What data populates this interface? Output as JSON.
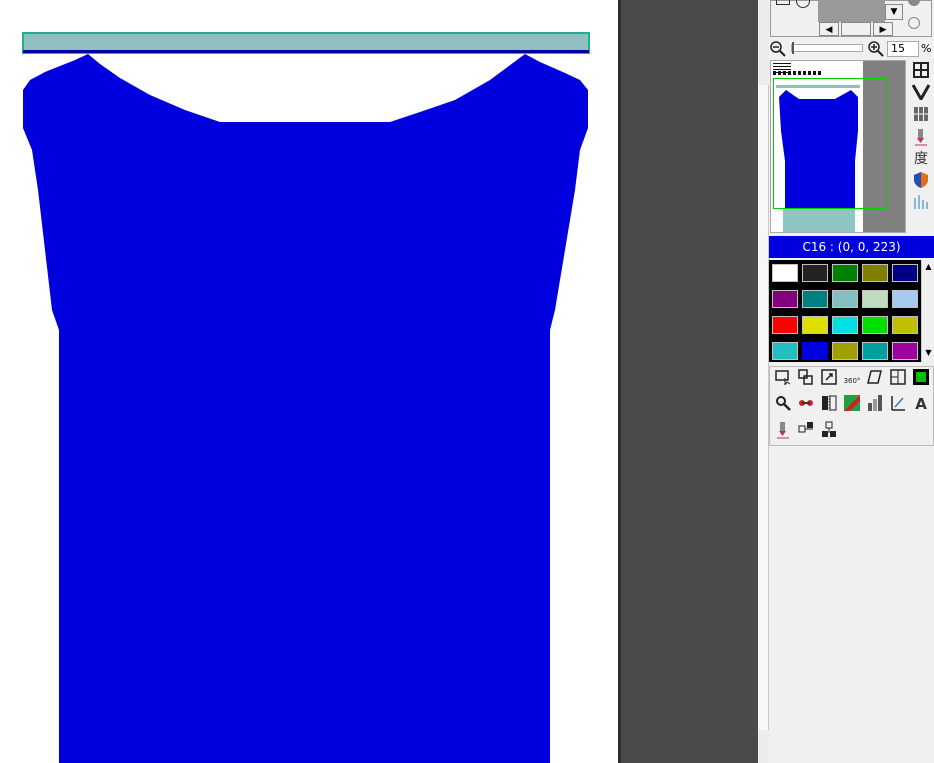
{
  "zoom": {
    "value": "15",
    "unit": "%"
  },
  "color_status": {
    "text": "C16 : (0, 0, 223)",
    "active_color": "#0000df"
  },
  "palette": {
    "colors": [
      "#ffffff",
      "#222222",
      "#008000",
      "#808000",
      "#000080",
      "#800080",
      "#008080",
      "#80c0c0",
      "#c0dcc0",
      "#a6caf0",
      "#ff0000",
      "#e0e000",
      "#00e0e0",
      "#00e000",
      "#c0c000",
      "#20c0c0",
      "#0000df",
      "#a0a000",
      "#00a0a0",
      "#a000a0"
    ],
    "selected_index": 16
  },
  "garment": {
    "fill": "#0000df",
    "rod_color": "#8fbfbf",
    "rod_border": "#20b090"
  },
  "side_icons": [
    "grid-icon",
    "v-shape-icon",
    "pattern-grid-icon",
    "pen-tool-icon",
    "degree-icon",
    "shield-icon",
    "needle-lines-icon"
  ],
  "side_degree_char": "度",
  "tool_rows": [
    [
      "select-rect-icon",
      "copy-shape-icon",
      "resize-icon",
      "rotate-360-icon",
      "skew-icon",
      "split-icon",
      "color-fill-icon"
    ],
    [
      "wrench-icon",
      "link-icon",
      "mirror-icon",
      "stripe-fill-icon",
      "stitch-icon",
      "measure-icon",
      "letter-icon"
    ],
    [
      "pen-tool-icon",
      "align-horizontal-icon",
      "align-vertical-icon"
    ]
  ],
  "rotate_label": "360°",
  "letter_label": "A"
}
